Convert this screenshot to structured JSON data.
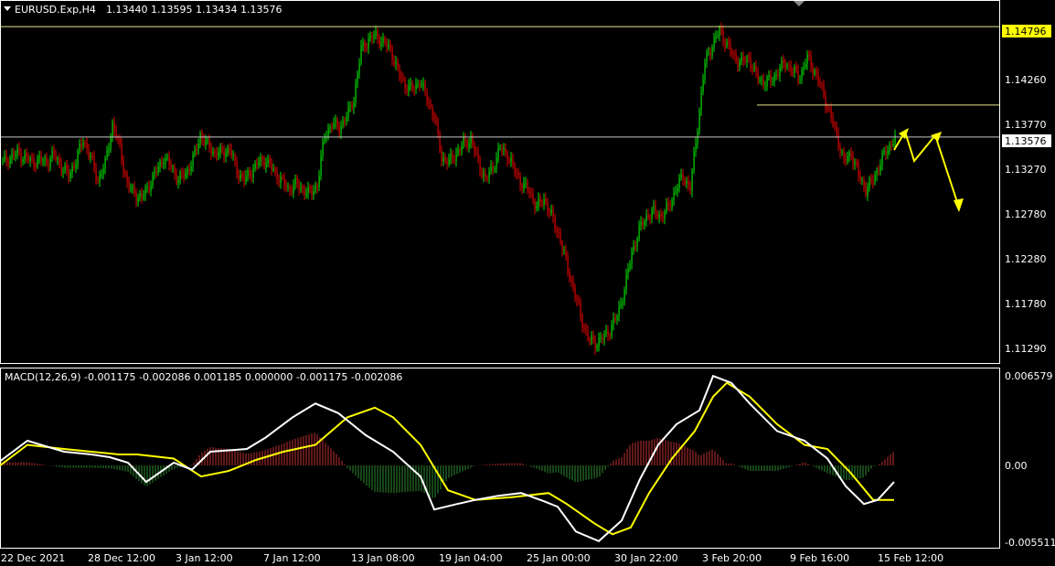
{
  "header": {
    "symbol_label": "EURUSD.Exp,H4",
    "ohlc": "1.13440 1.13595 1.13434 1.13576"
  },
  "macd": {
    "label": "MACD(12,26,9) -0.001175 -0.002086 0.001185 0.000000 -0.001175 -0.002086",
    "scale": [
      "0.006579",
      "0.00",
      "-0.005511"
    ],
    "range": [
      -0.00551,
      0.00658
    ]
  },
  "price_scale": {
    "ticks": [
      "1.14260",
      "1.13770",
      "1.13270",
      "1.12780",
      "1.12280",
      "1.11780",
      "1.11290"
    ],
    "range": [
      1.1109,
      1.1505
    ]
  },
  "levels": {
    "resistance_label": "1.14796",
    "resistance_value": 1.14796,
    "current_label": "1.13576",
    "current_value": 1.13576,
    "mid_level_value": 1.1393
  },
  "time_axis": [
    "22 Dec 2021",
    "28 Dec 12:00",
    "3 Jan 12:00",
    "7 Jan 12:00",
    "13 Jan 08:00",
    "19 Jan 04:00",
    "25 Jan 00:00",
    "30 Jan 22:00",
    "3 Feb 20:00",
    "9 Feb 16:00",
    "15 Feb 12:00"
  ],
  "colors": {
    "bull": "#00e000",
    "bear": "#e00000",
    "macd_main": "#ffffff",
    "macd_signal": "#ffff00",
    "hist_pos": "#c03030",
    "hist_neg": "#2e8b2e",
    "level_line": "#e6e68c",
    "grid_frame": "#ffffff",
    "annotation_arrow": "#ffff00"
  },
  "chart_data": {
    "type": "candlestick",
    "close_path": [
      [
        0,
        1.133
      ],
      [
        4,
        1.1335
      ],
      [
        8,
        1.134
      ],
      [
        12,
        1.1335
      ],
      [
        16,
        1.133
      ],
      [
        20,
        1.1332
      ],
      [
        24,
        1.133
      ],
      [
        28,
        1.1338
      ],
      [
        32,
        1.1325
      ],
      [
        36,
        1.1315
      ],
      [
        40,
        1.1332
      ],
      [
        44,
        1.1355
      ],
      [
        48,
        1.1335
      ],
      [
        52,
        1.131
      ],
      [
        56,
        1.1328
      ],
      [
        60,
        1.1372
      ],
      [
        64,
        1.1345
      ],
      [
        68,
        1.1305
      ],
      [
        72,
        1.1295
      ],
      [
        76,
        1.129
      ],
      [
        80,
        1.1305
      ],
      [
        84,
        1.132
      ],
      [
        88,
        1.1335
      ],
      [
        92,
        1.1325
      ],
      [
        96,
        1.131
      ],
      [
        100,
        1.1318
      ],
      [
        104,
        1.1332
      ],
      [
        108,
        1.136
      ],
      [
        112,
        1.1348
      ],
      [
        116,
        1.134
      ],
      [
        120,
        1.134
      ],
      [
        124,
        1.1345
      ],
      [
        128,
        1.132
      ],
      [
        132,
        1.131
      ],
      [
        136,
        1.132
      ],
      [
        140,
        1.133
      ],
      [
        144,
        1.1332
      ],
      [
        148,
        1.132
      ],
      [
        152,
        1.131
      ],
      [
        156,
        1.13
      ],
      [
        160,
        1.1305
      ],
      [
        164,
        1.13
      ],
      [
        168,
        1.1295
      ],
      [
        172,
        1.1305
      ],
      [
        176,
        1.136
      ],
      [
        180,
        1.1372
      ],
      [
        184,
        1.1368
      ],
      [
        188,
        1.138
      ],
      [
        192,
        1.14
      ],
      [
        196,
        1.1455
      ],
      [
        200,
        1.1465
      ],
      [
        204,
        1.147
      ],
      [
        208,
        1.1462
      ],
      [
        212,
        1.1455
      ],
      [
        216,
        1.143
      ],
      [
        220,
        1.1415
      ],
      [
        224,
        1.141
      ],
      [
        228,
        1.142
      ],
      [
        232,
        1.14
      ],
      [
        236,
        1.138
      ],
      [
        240,
        1.1335
      ],
      [
        244,
        1.133
      ],
      [
        248,
        1.134
      ],
      [
        252,
        1.135
      ],
      [
        256,
        1.1355
      ],
      [
        260,
        1.133
      ],
      [
        264,
        1.131
      ],
      [
        268,
        1.1325
      ],
      [
        272,
        1.1345
      ],
      [
        276,
        1.1338
      ],
      [
        280,
        1.132
      ],
      [
        284,
        1.1305
      ],
      [
        288,
        1.1298
      ],
      [
        292,
        1.128
      ],
      [
        296,
        1.129
      ],
      [
        300,
        1.127
      ],
      [
        304,
        1.125
      ],
      [
        308,
        1.122
      ],
      [
        312,
        1.119
      ],
      [
        316,
        1.116
      ],
      [
        320,
        1.1135
      ],
      [
        324,
        1.113
      ],
      [
        328,
        1.1135
      ],
      [
        332,
        1.1145
      ],
      [
        336,
        1.116
      ],
      [
        340,
        1.119
      ],
      [
        344,
        1.123
      ],
      [
        348,
        1.1255
      ],
      [
        352,
        1.127
      ],
      [
        356,
        1.1275
      ],
      [
        360,
        1.127
      ],
      [
        364,
        1.128
      ],
      [
        368,
        1.13
      ],
      [
        372,
        1.1315
      ],
      [
        376,
        1.13
      ],
      [
        380,
        1.137
      ],
      [
        384,
        1.144
      ],
      [
        388,
        1.146
      ],
      [
        392,
        1.1475
      ],
      [
        396,
        1.146
      ],
      [
        400,
        1.1445
      ],
      [
        404,
        1.144
      ],
      [
        408,
        1.1445
      ],
      [
        412,
        1.1425
      ],
      [
        416,
        1.1418
      ],
      [
        420,
        1.142
      ],
      [
        424,
        1.143
      ],
      [
        428,
        1.144
      ],
      [
        432,
        1.143
      ],
      [
        436,
        1.1425
      ],
      [
        440,
        1.1445
      ],
      [
        444,
        1.143
      ],
      [
        448,
        1.141
      ],
      [
        452,
        1.1385
      ],
      [
        456,
        1.136
      ],
      [
        460,
        1.133
      ],
      [
        464,
        1.134
      ],
      [
        468,
        1.1315
      ],
      [
        472,
        1.13
      ],
      [
        476,
        1.131
      ],
      [
        480,
        1.133
      ],
      [
        484,
        1.1345
      ],
      [
        488,
        1.1357
      ]
    ]
  }
}
